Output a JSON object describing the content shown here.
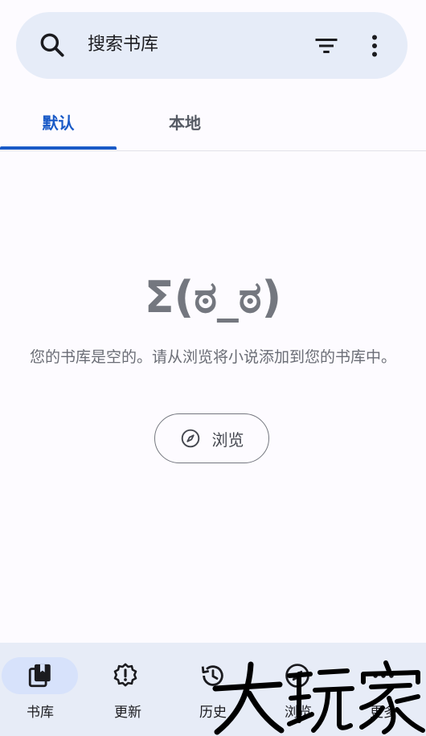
{
  "search": {
    "placeholder": "搜索书库",
    "icons": [
      "search-icon",
      "filter-icon",
      "more-vert-icon"
    ]
  },
  "tabs": [
    {
      "label": "默认",
      "active": true
    },
    {
      "label": "本地",
      "active": false
    }
  ],
  "empty_state": {
    "kaomoji": "Σ(ಠ_ಠ)",
    "message": "您的书库是空的。请从浏览将小说添加到您的书库中。",
    "browse_button": "浏览"
  },
  "bottom_nav": [
    {
      "label": "书库",
      "icon": "library-icon",
      "active": true
    },
    {
      "label": "更新",
      "icon": "updates-icon",
      "active": false
    },
    {
      "label": "历史",
      "icon": "history-icon",
      "active": false
    },
    {
      "label": "浏览",
      "icon": "compass-icon",
      "active": false
    },
    {
      "label": "更多",
      "icon": "more-icon",
      "active": false
    }
  ],
  "watermark": "大玩家",
  "colors": {
    "accent": "#1a5ac7",
    "surface": "#e6ecf8",
    "nav_background": "#e7ecf7",
    "active_pill": "#d7e2fb"
  }
}
